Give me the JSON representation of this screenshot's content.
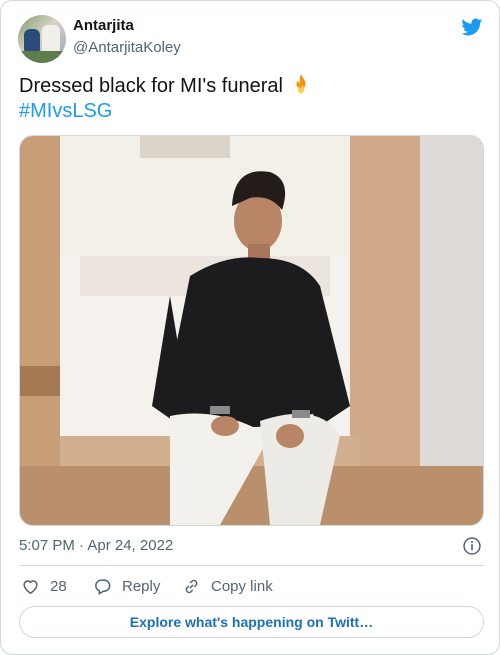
{
  "author": {
    "name": "Antarjita",
    "handle": "@AntarjitaKoley",
    "avatar_icon": "profile-avatar-icon"
  },
  "tweet": {
    "text": "Dressed black for MI's funeral",
    "emoji": "fire",
    "hashtag": "#MIvsLSG",
    "media_icon": "photo-image"
  },
  "meta": {
    "timestamp": "5:07 PM · Apr 24, 2022"
  },
  "actions": {
    "like_count": "28",
    "reply_label": "Reply",
    "copy_link_label": "Copy link"
  },
  "explore": {
    "label": "Explore what's happening on Twitt…"
  },
  "colors": {
    "brand_blue": "#1d9bf0",
    "link_blue": "#1d6fb8",
    "secondary_text": "#536471",
    "border": "#cfd9de"
  }
}
